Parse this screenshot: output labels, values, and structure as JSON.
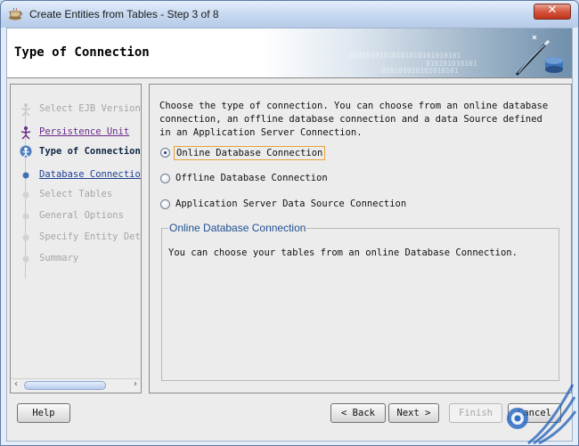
{
  "window": {
    "title": "Create Entities from Tables - Step 3 of 8",
    "close_glyph": "✕"
  },
  "banner": {
    "title": "Type of Connection",
    "binary_row_1": "01010101010101010101010101",
    "binary_row_2": "010101010101",
    "binary_row_3": "010101010101010101"
  },
  "steps": [
    {
      "label": "Select EJB Version",
      "state": "disabled"
    },
    {
      "label": "Persistence Unit",
      "state": "visited"
    },
    {
      "label": "Type of Connection",
      "state": "current"
    },
    {
      "label": "Database Connection",
      "state": "link"
    },
    {
      "label": "Select Tables",
      "state": "disabled"
    },
    {
      "label": "General Options",
      "state": "disabled"
    },
    {
      "label": "Specify Entity Details",
      "state": "disabled"
    },
    {
      "label": "Summary",
      "state": "disabled"
    }
  ],
  "steps_scroll": {
    "left_arrow": "‹",
    "right_arrow": "›"
  },
  "content": {
    "description": "Choose the type of connection. You can choose from an online database connection, an offline database connection and a data Source defined in an Application Server Connection.",
    "options": [
      {
        "label": "Online Database Connection",
        "selected": true
      },
      {
        "label": "Offline Database Connection",
        "selected": false
      },
      {
        "label": "Application Server Data Source Connection",
        "selected": false
      }
    ],
    "group": {
      "title": "Online Database Connection",
      "text": "You can choose your tables from an online Database Connection."
    }
  },
  "buttons": {
    "help": "Help",
    "back": "< Back",
    "next": "Next >",
    "finish": "Finish",
    "cancel": "Cancel"
  },
  "colors": {
    "accent": "#1f4f91",
    "link": "#1f3f92",
    "visited": "#6a2a8a",
    "close": "#c0341d"
  }
}
